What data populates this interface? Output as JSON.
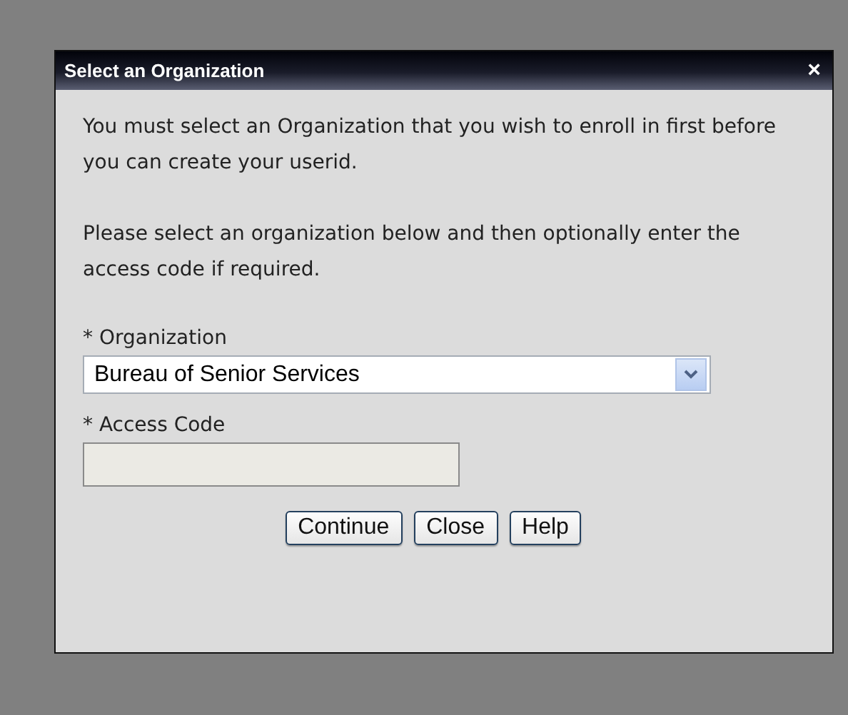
{
  "window": {
    "title": "Select an Organization",
    "close": "×"
  },
  "paragraphs": [
    "You must select an Organization that you wish to enroll in first before you can create your userid.",
    "Please select an organization below and then optionally enter the access code if required."
  ],
  "fields": [
    {
      "kind": "select",
      "label": "* Organization",
      "value": "Bureau of Senior Services",
      "disabled": false
    },
    {
      "kind": "text",
      "label": "* Access Code",
      "disabled": true
    }
  ],
  "buttons": [
    "Continue",
    "Close",
    "Help"
  ]
}
